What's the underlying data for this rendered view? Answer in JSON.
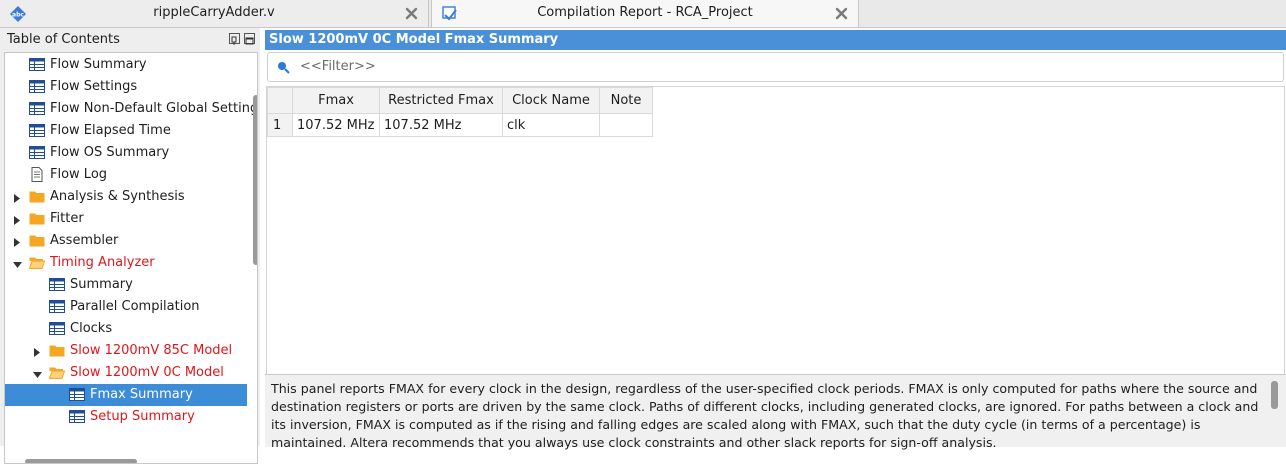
{
  "tabs": [
    {
      "title": "rippleCarryAdder.v",
      "icon": "abc-file-icon"
    },
    {
      "title": "Compilation Report - RCA_Project",
      "icon": "report-icon"
    }
  ],
  "toc": {
    "title": "Table of Contents",
    "items": [
      {
        "label": "Flow Summary",
        "icon": "table-icon",
        "expander": "none",
        "color": "normal"
      },
      {
        "label": "Flow Settings",
        "icon": "table-icon",
        "expander": "none",
        "color": "normal"
      },
      {
        "label": "Flow Non-Default Global Settings",
        "icon": "table-icon",
        "expander": "none",
        "color": "normal"
      },
      {
        "label": "Flow Elapsed Time",
        "icon": "table-icon",
        "expander": "none",
        "color": "normal"
      },
      {
        "label": "Flow OS Summary",
        "icon": "table-icon",
        "expander": "none",
        "color": "normal"
      },
      {
        "label": "Flow Log",
        "icon": "document-icon",
        "expander": "none",
        "color": "normal"
      },
      {
        "label": "Analysis & Synthesis",
        "icon": "folder-icon",
        "expander": "collapsed",
        "color": "normal"
      },
      {
        "label": "Fitter",
        "icon": "folder-icon",
        "expander": "collapsed",
        "color": "normal"
      },
      {
        "label": "Assembler",
        "icon": "folder-icon",
        "expander": "collapsed",
        "color": "normal"
      },
      {
        "label": "Timing Analyzer",
        "icon": "open-folder-icon",
        "expander": "expanded",
        "color": "red"
      },
      {
        "label": "Summary",
        "icon": "table-icon",
        "expander": "none",
        "color": "normal"
      },
      {
        "label": "Parallel Compilation",
        "icon": "table-icon",
        "expander": "none",
        "color": "normal"
      },
      {
        "label": "Clocks",
        "icon": "table-icon",
        "expander": "none",
        "color": "normal"
      },
      {
        "label": "Slow 1200mV 85C Model",
        "icon": "folder-icon",
        "expander": "collapsed",
        "color": "red"
      },
      {
        "label": "Slow 1200mV 0C Model",
        "icon": "open-folder-icon",
        "expander": "expanded",
        "color": "red"
      },
      {
        "label": "Fmax Summary",
        "icon": "table-icon",
        "expander": "none",
        "color": "selected"
      },
      {
        "label": "Setup Summary",
        "icon": "table-icon",
        "expander": "none",
        "color": "red"
      }
    ]
  },
  "report": {
    "title": "Slow 1200mV 0C Model Fmax Summary",
    "filter_placeholder": "<<Filter>>",
    "columns": [
      "",
      "Fmax",
      "Restricted Fmax",
      "Clock Name",
      "Note"
    ],
    "rows": [
      {
        "num": "1",
        "fmax": "107.52 MHz",
        "restricted": "107.52 MHz",
        "clock": "clk",
        "note": ""
      }
    ],
    "description": "This panel reports FMAX for every clock in the design, regardless of the user-specified clock periods.  FMAX is only computed for paths where the source and destination registers or ports are driven by the same clock.  Paths of different clocks, including generated clocks, are ignored.  For paths between a clock and its inversion, FMAX is computed as if the rising and falling edges are scaled along with FMAX, such that the duty cycle (in terms of a percentage) is maintained. Altera recommends that you always use clock constraints and other slack reports for sign-off analysis."
  },
  "colors": {
    "accent": "#4a90d9",
    "selection": "#3d8cd8",
    "red_text": "#e0161a",
    "folder": "#f5a623"
  }
}
